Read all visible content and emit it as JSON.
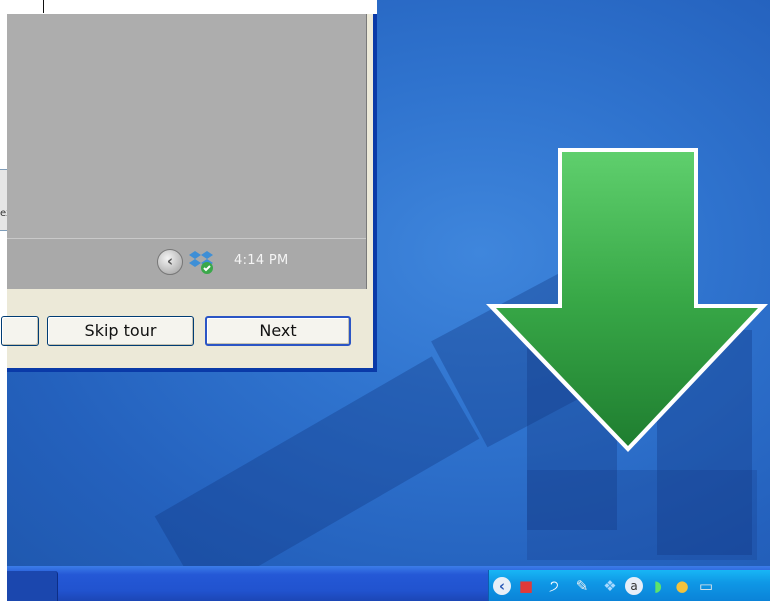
{
  "tour": {
    "preview": {
      "clock": "4:14 PM"
    },
    "buttons": {
      "skip_label": "Skip tour",
      "next_label": "Next"
    }
  },
  "side_fragment_text": "ex",
  "colors": {
    "arrow_green": "#2e9a3c",
    "desktop_blue": "#2f73ce",
    "window_border": "#0a3aa8",
    "tray_blue": "#0f98e6"
  },
  "tray_icons": [
    "back-chevron-icon",
    "network-alert-icon",
    "audio-icon",
    "pen-icon",
    "dropbox-icon",
    "a-icon",
    "wifi-icon",
    "security-icon",
    "display-icon"
  ]
}
